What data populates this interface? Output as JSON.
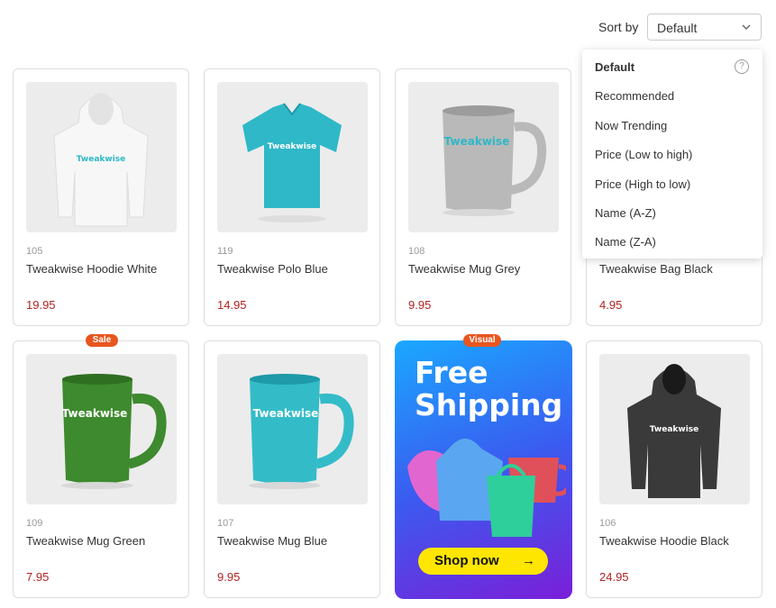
{
  "sort": {
    "label": "Sort by",
    "selected": "Default",
    "options": [
      "Default",
      "Recommended",
      "Now Trending",
      "Price (Low to high)",
      "Price (High to low)",
      "Name (A-Z)",
      "Name (Z-A)"
    ]
  },
  "products": [
    {
      "sku": "105",
      "title": "Tweakwise Hoodie White",
      "price": "19.95",
      "brand": "Tweakwise"
    },
    {
      "sku": "119",
      "title": "Tweakwise Polo Blue",
      "price": "14.95",
      "brand": "Tweakwise"
    },
    {
      "sku": "108",
      "title": "Tweakwise Mug Grey",
      "price": "9.95",
      "brand": "Tweakwise"
    },
    {
      "sku": "",
      "title": "Tweakwise Bag Black",
      "price": "4.95",
      "brand": "Tweakwise"
    },
    {
      "sku": "109",
      "title": "Tweakwise Mug Green",
      "price": "7.95",
      "brand": "Tweakwise",
      "badge": "Sale"
    },
    {
      "sku": "107",
      "title": "Tweakwise Mug Blue",
      "price": "9.95",
      "brand": "Tweakwise"
    },
    {
      "sku": "106",
      "title": "Tweakwise Hoodie Black",
      "price": "24.95",
      "brand": "Tweakwise"
    }
  ],
  "promo": {
    "badge": "Visual",
    "line1": "Free",
    "line2": "Shipping",
    "cta": "Shop now",
    "arrow": "→"
  },
  "colors": {
    "price": "#b22222",
    "badge": "#e8561f",
    "cta": "#ffe600"
  }
}
